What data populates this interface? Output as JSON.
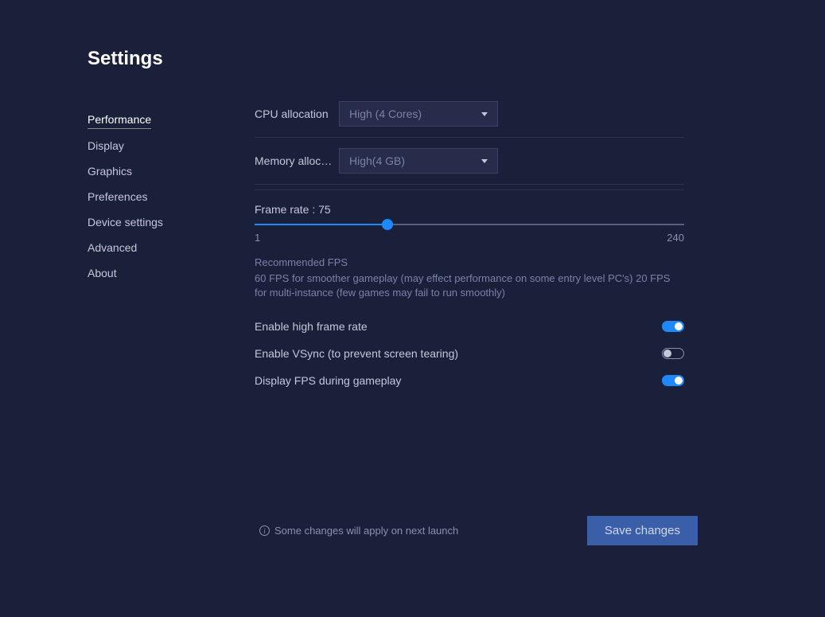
{
  "page_title": "Settings",
  "sidebar": {
    "items": [
      {
        "label": "Performance",
        "active": true
      },
      {
        "label": "Display",
        "active": false
      },
      {
        "label": "Graphics",
        "active": false
      },
      {
        "label": "Preferences",
        "active": false
      },
      {
        "label": "Device settings",
        "active": false
      },
      {
        "label": "Advanced",
        "active": false
      },
      {
        "label": "About",
        "active": false
      }
    ]
  },
  "cpu": {
    "label": "CPU allocation",
    "value": "High (4 Cores)"
  },
  "memory": {
    "label": "Memory alloc…",
    "value": "High(4 GB)"
  },
  "framerate": {
    "label_prefix": "Frame rate : ",
    "value": "75",
    "min": "1",
    "max": "240"
  },
  "recommendation": {
    "title": "Recommended FPS",
    "text": "60 FPS for smoother gameplay (may effect performance on some entry level PC's) 20 FPS for multi-instance (few games may fail to run smoothly)"
  },
  "toggles": {
    "high_frame": {
      "label": "Enable high frame rate",
      "on": true
    },
    "vsync": {
      "label": "Enable VSync (to prevent screen tearing)",
      "on": false
    },
    "display_fps": {
      "label": "Display FPS during gameplay",
      "on": true
    }
  },
  "footer": {
    "note": "Some changes will apply on next launch",
    "save_label": "Save changes"
  }
}
